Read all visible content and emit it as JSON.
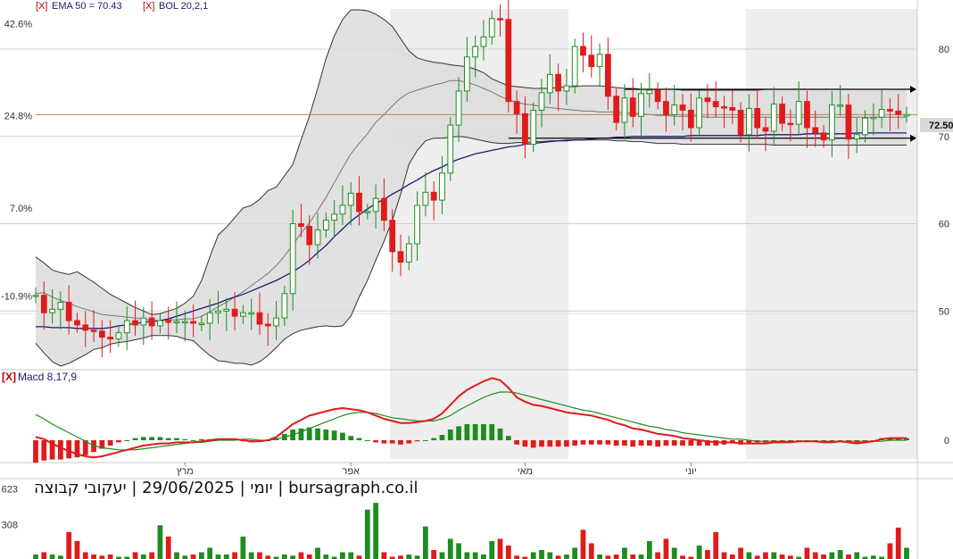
{
  "legend": {
    "ema_close": "[X]",
    "ema_label": "EMA 50 = 70.43",
    "bol_close": "[X]",
    "bol_label": "BOL 20,2,1"
  },
  "macd_panel": {
    "close": "[X]",
    "label": "Macd 8,17,9"
  },
  "footer_text": "יומי | 29/06/2025 | יעקובי קבוצה | bursagraph.co.il",
  "price_tag": "72.50",
  "colors": {
    "up_candle": "#1e8c1e",
    "down_candle": "#e01b1b",
    "ema": "#1c1c7a",
    "bollinger_fill": "#dcdcdc",
    "bollinger_line": "#333333",
    "price_line": "#c08040",
    "macd_line": "#e01b1b",
    "signal_line": "#1e8c1e"
  },
  "chart_data": [
    {
      "type": "candlestick",
      "title": "",
      "x_labels": [
        "מרץ",
        "אפר",
        "מאי",
        "יוני"
      ],
      "y_left_ticks": [
        "42.6%",
        "24.8%",
        "7.0%",
        "-10.9%"
      ],
      "y_right_ticks": [
        80,
        70,
        60,
        50
      ],
      "ylim": [
        44.3,
        84.4
      ],
      "last_price": 72.5,
      "ema50_last": 70.43,
      "support_level": 69.8,
      "resistance_level": 75.4,
      "close": [
        51.8,
        49.8,
        50.2,
        51.0,
        48.9,
        48.4,
        47.8,
        47.7,
        47.0,
        46.8,
        47.5,
        48.9,
        48.4,
        49.2,
        48.3,
        48.9,
        48.7,
        48.8,
        48.8,
        48.6,
        48.6,
        49.8,
        50.0,
        50.2,
        49.4,
        49.8,
        49.8,
        48.5,
        48.3,
        49.2,
        52.0,
        60.0,
        59.7,
        57.6,
        59.3,
        60.4,
        61.1,
        62.1,
        63.5,
        61.4,
        61.4,
        62.9,
        60.4,
        56.8,
        55.6,
        57.7,
        62.1,
        63.6,
        62.7,
        65.8,
        71.3,
        75.2,
        79.1,
        80.3,
        81.4,
        83.5,
        83.4,
        74.0,
        72.6,
        69.1,
        73.0,
        75.0,
        77.1,
        75.2,
        75.8,
        80.3,
        79.3,
        78.0,
        79.4,
        74.6,
        71.6,
        74.4,
        72.3,
        74.9,
        75.3,
        74.0,
        72.5,
        73.6,
        73.0,
        71.0,
        74.4,
        74.0,
        73.4,
        73.3,
        73.0,
        70.2,
        73.2,
        71.0,
        70.6,
        73.7,
        71.5,
        71.4,
        74.0,
        71.0,
        70.4,
        69.6,
        73.6,
        73.6,
        69.7,
        70.2,
        72.1,
        72.2,
        73.1,
        72.9,
        72.5,
        72.5
      ],
      "ema50": [
        48.2,
        48.2,
        48.1,
        48.1,
        48.1,
        48.0,
        48.0,
        48.0,
        48.0,
        48.1,
        48.3,
        48.4,
        48.6,
        48.7,
        48.8,
        48.9,
        49.1,
        49.4,
        49.7,
        50.0,
        50.3,
        50.6,
        50.9,
        51.3,
        51.6,
        51.9,
        52.3,
        52.7,
        53.1,
        53.5,
        54.0,
        54.5,
        55.1,
        55.8,
        56.7,
        57.5,
        58.5,
        59.4,
        60.3,
        61.0,
        61.7,
        62.3,
        62.8,
        63.4,
        63.9,
        64.5,
        65.0,
        65.6,
        66.1,
        66.5,
        67.0,
        67.4,
        67.7,
        68.0,
        68.2,
        68.4,
        68.6,
        68.8,
        68.9,
        69.1,
        69.2,
        69.3,
        69.4,
        69.5,
        69.5,
        69.6,
        69.6,
        69.7,
        69.8,
        69.8,
        69.9,
        69.9,
        70.0,
        70.0,
        70.0,
        70.0,
        70.0,
        70.0,
        70.0,
        70.1,
        70.1,
        70.1,
        70.1,
        70.1,
        70.1,
        70.1,
        70.1,
        70.1,
        70.2,
        70.2,
        70.2,
        70.2,
        70.2,
        70.3,
        70.3,
        70.3,
        70.3,
        70.3,
        70.3,
        70.4,
        70.4,
        70.4,
        70.4,
        70.4,
        70.4,
        70.4
      ],
      "bb_upper": [
        56.2,
        55.5,
        54.7,
        54.4,
        54.2,
        54.5,
        53.9,
        53.3,
        52.6,
        51.9,
        51.4,
        50.9,
        50.4,
        50.0,
        49.6,
        49.7,
        50.0,
        50.3,
        50.9,
        51.7,
        53.5,
        56.2,
        58.7,
        59.6,
        60.7,
        61.8,
        62.1,
        62.8,
        63.8,
        64.2,
        65.5,
        66.8,
        69.6,
        72.3,
        75.5,
        78.9,
        81.5,
        83.4,
        84.5,
        84.5,
        84.4,
        84.0,
        83.4,
        82.6,
        81.2,
        79.8,
        79.0,
        78.7,
        78.5,
        78.4,
        78.2,
        78.1,
        78.0,
        77.7,
        77.3,
        76.6,
        76.2,
        75.8,
        75.7,
        75.6,
        75.5,
        75.5,
        75.5,
        75.6,
        75.7,
        75.7,
        75.8,
        75.8,
        75.8,
        75.7,
        75.6,
        75.5,
        75.5,
        75.4,
        75.4,
        75.4,
        75.4,
        75.4,
        75.3,
        75.3,
        75.3,
        75.3,
        75.3,
        75.3,
        75.3,
        75.3,
        75.3,
        75.3,
        75.4,
        75.4,
        75.4,
        75.4,
        75.4,
        75.4,
        75.4,
        75.4,
        75.4,
        75.4,
        75.4,
        75.4,
        75.4,
        75.4,
        75.4,
        75.4,
        75.4,
        75.4
      ],
      "bb_mid": [
        52.0,
        52.1,
        51.6,
        51.2,
        50.9,
        50.5,
        50.2,
        49.9,
        49.6,
        49.5,
        49.4,
        49.3,
        49.2,
        49.1,
        48.9,
        48.9,
        49.0,
        49.0,
        49.1,
        49.1,
        49.4,
        49.9,
        50.5,
        51.0,
        51.6,
        52.2,
        52.9,
        53.6,
        54.3,
        55.2,
        56.3,
        57.6,
        58.9,
        60.1,
        61.5,
        63.0,
        64.7,
        66.4,
        68.0,
        69.2,
        70.3,
        71.6,
        72.5,
        73.5,
        74.4,
        75.0,
        75.3,
        75.6,
        75.9,
        76.1,
        76.4,
        76.4,
        76.2,
        75.9,
        75.5,
        75.1,
        74.6,
        74.2,
        73.9,
        73.7,
        73.6,
        73.4,
        73.3,
        73.2,
        73.1,
        73.0,
        72.9,
        72.9,
        72.8,
        72.8,
        72.8,
        72.7,
        72.7,
        72.6,
        72.5,
        72.4,
        72.4,
        72.3,
        72.3,
        72.3,
        72.3,
        72.2,
        72.2,
        72.2,
        72.2,
        72.2,
        72.2,
        72.2,
        72.2,
        72.2,
        72.2,
        72.2,
        72.2,
        72.2,
        72.2,
        72.2,
        72.2,
        72.2,
        72.2,
        72.2,
        72.2,
        72.2,
        72.2,
        72.2,
        72.2,
        72.2
      ],
      "bb_lower": [
        46.3,
        45.2,
        44.2,
        43.7,
        44.0,
        44.5,
        45.0,
        45.6,
        45.8,
        46.2,
        46.4,
        46.5,
        46.7,
        46.9,
        47.2,
        47.2,
        47.2,
        47.1,
        46.8,
        46.6,
        45.7,
        44.9,
        44.3,
        44.2,
        44.0,
        44.0,
        43.8,
        44.2,
        44.9,
        45.8,
        46.8,
        47.4,
        47.8,
        48.0,
        48.2,
        48.3,
        48.2,
        48.3,
        49.4,
        51.6,
        53.5,
        55.8,
        58.0,
        60.4,
        63.4,
        66.8,
        68.4,
        69.5,
        69.8,
        69.8,
        69.9,
        70.0,
        69.9,
        69.7,
        69.5,
        69.3,
        69.2,
        69.2,
        69.3,
        69.3,
        69.4,
        69.4,
        69.5,
        69.5,
        69.6,
        69.6,
        69.6,
        69.6,
        69.6,
        69.6,
        69.5,
        69.5,
        69.4,
        69.4,
        69.3,
        69.2,
        69.2,
        69.2,
        69.1,
        69.1,
        69.1,
        69.1,
        69.1,
        69.1,
        69.1,
        69.1,
        69.1,
        69.1,
        69.1,
        69.0,
        69.0,
        69.0,
        69.0,
        69.0,
        69.0,
        69.0,
        69.0,
        69.0,
        69.0,
        69.0,
        69.0,
        69.0,
        69.0,
        69.0,
        69.0,
        69.0
      ]
    },
    {
      "type": "line",
      "title": "Macd 8,17,9",
      "y_ticks": [
        0
      ],
      "macd": [
        0.3,
        0.1,
        -0.3,
        -0.7,
        -1.0,
        -1.3,
        -1.5,
        -1.6,
        -1.5,
        -1.3,
        -1.1,
        -0.9,
        -0.7,
        -0.5,
        -0.4,
        -0.3,
        -0.3,
        -0.2,
        -0.2,
        -0.2,
        -0.1,
        0.0,
        0.1,
        0.1,
        0.1,
        0.0,
        -0.1,
        -0.1,
        0.0,
        0.3,
        0.9,
        1.5,
        1.9,
        2.3,
        2.5,
        2.7,
        2.9,
        3.0,
        2.9,
        2.8,
        2.6,
        2.3,
        2.0,
        1.8,
        1.6,
        1.6,
        1.7,
        1.8,
        2.0,
        2.5,
        3.3,
        4.1,
        4.7,
        5.1,
        5.5,
        5.8,
        5.6,
        4.9,
        4.0,
        3.6,
        3.3,
        3.2,
        3.0,
        2.8,
        2.6,
        2.5,
        2.4,
        2.3,
        2.1,
        1.9,
        1.6,
        1.4,
        1.1,
        1.0,
        0.8,
        0.6,
        0.5,
        0.4,
        0.2,
        0.1,
        0.0,
        -0.1,
        -0.2,
        -0.2,
        -0.2,
        -0.3,
        -0.3,
        -0.3,
        -0.3,
        -0.2,
        -0.2,
        -0.2,
        -0.1,
        -0.1,
        -0.1,
        -0.2,
        -0.2,
        -0.1,
        -0.2,
        -0.3,
        -0.2,
        -0.1,
        0.1,
        0.2,
        0.2,
        0.2
      ],
      "signal": [
        2.4,
        2.0,
        1.5,
        1.1,
        0.7,
        0.3,
        -0.1,
        -0.5,
        -0.7,
        -0.8,
        -0.9,
        -0.9,
        -0.9,
        -0.8,
        -0.7,
        -0.6,
        -0.5,
        -0.4,
        -0.3,
        -0.2,
        -0.2,
        -0.1,
        0.0,
        0.0,
        0.0,
        0.1,
        0.1,
        0.0,
        0.0,
        0.1,
        0.3,
        0.5,
        0.8,
        1.1,
        1.4,
        1.7,
        2.0,
        2.3,
        2.5,
        2.6,
        2.6,
        2.5,
        2.3,
        2.1,
        2.0,
        1.9,
        1.8,
        1.8,
        1.8,
        2.0,
        2.3,
        2.8,
        3.2,
        3.6,
        4.0,
        4.3,
        4.5,
        4.5,
        4.4,
        4.2,
        4.0,
        3.8,
        3.6,
        3.4,
        3.2,
        3.0,
        2.8,
        2.7,
        2.5,
        2.3,
        2.1,
        1.9,
        1.7,
        1.5,
        1.3,
        1.2,
        1.0,
        0.9,
        0.7,
        0.6,
        0.5,
        0.4,
        0.3,
        0.2,
        0.1,
        0.1,
        0.0,
        -0.1,
        -0.1,
        -0.1,
        -0.1,
        -0.1,
        -0.1,
        -0.1,
        -0.1,
        -0.1,
        -0.1,
        -0.1,
        -0.1,
        -0.1,
        -0.1,
        -0.1,
        -0.1,
        0.0,
        0.0,
        0.0
      ]
    },
    {
      "type": "bar",
      "title": "",
      "y_ticks": [
        623,
        308
      ],
      "volume": [
        40,
        60,
        40,
        30,
        240,
        160,
        60,
        40,
        30,
        40,
        20,
        20,
        60,
        40,
        60,
        300,
        200,
        60,
        30,
        40,
        60,
        100,
        40,
        40,
        60,
        200,
        60,
        60,
        30,
        20,
        40,
        30,
        60,
        40,
        100,
        40,
        20,
        60,
        60,
        30,
        440,
        500,
        60,
        20,
        30,
        40,
        30,
        290,
        80,
        60,
        180,
        140,
        60,
        60,
        40,
        160,
        180,
        120,
        30,
        20,
        60,
        80,
        60,
        30,
        40,
        100,
        260,
        140,
        40,
        30,
        40,
        100,
        40,
        40,
        160,
        60,
        180,
        100,
        30,
        20,
        120,
        80,
        240,
        60,
        40,
        100,
        60,
        30,
        60,
        60,
        40,
        30,
        20,
        100,
        60,
        40,
        60,
        80,
        40,
        60,
        20,
        30,
        20,
        140,
        280,
        100
      ]
    }
  ]
}
